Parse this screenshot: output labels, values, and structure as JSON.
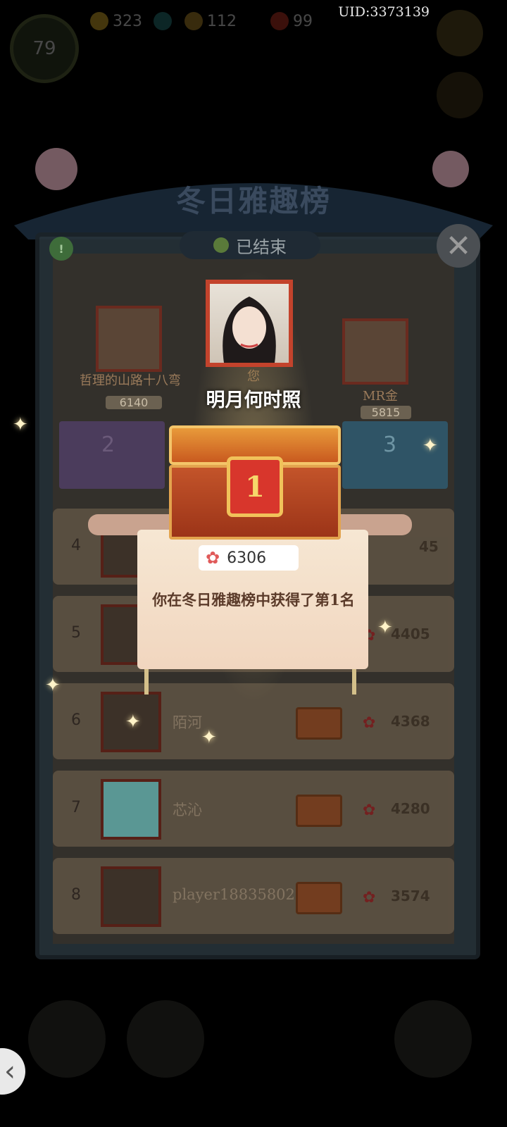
{
  "hud": {
    "level": "79",
    "resources": [
      {
        "icon": "lightning-icon",
        "value": "323",
        "color": "#f2c230"
      },
      {
        "icon": "coin-icon",
        "value": "112",
        "color": "#2e8a8a"
      },
      {
        "icon": "ingot-icon",
        "value": "99",
        "color": "#d43a2a"
      }
    ],
    "uid": "UID:3373139"
  },
  "board": {
    "title": "冬日雅趣榜",
    "status": "已结束"
  },
  "podium": [
    {
      "rank": "2",
      "name": "哲理的山路十八弯",
      "score": "6140"
    },
    {
      "rank": "1",
      "name": "您",
      "score": ""
    },
    {
      "rank": "3",
      "name": "MR金",
      "score": "5815"
    }
  ],
  "rows": [
    {
      "rank": "4",
      "name": "",
      "score": "45"
    },
    {
      "rank": "5",
      "name": "",
      "score": "4405"
    },
    {
      "rank": "6",
      "name": "陌河",
      "score": "4368"
    },
    {
      "rank": "7",
      "name": "芯沁",
      "score": "4280"
    },
    {
      "rank": "8",
      "name": "player18835802",
      "score": "3574"
    }
  ],
  "popup": {
    "winner_name": "明月何时照",
    "medal": "1",
    "score": "6306",
    "message": "你在冬日雅趣榜中获得了第1名"
  }
}
